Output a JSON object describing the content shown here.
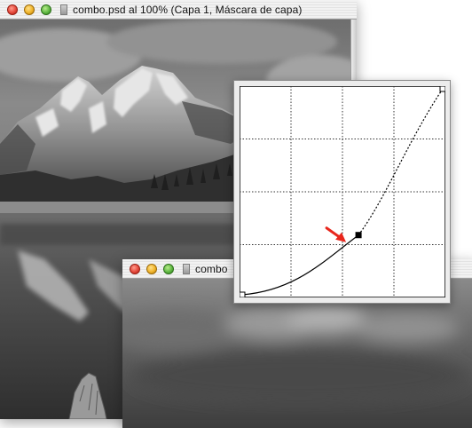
{
  "windows": {
    "main": {
      "title": "combo.psd al 100% (Capa 1, Máscara de capa)"
    },
    "second": {
      "title": "combo"
    }
  },
  "curves": {
    "grid_divisions": 4,
    "control_point": {
      "input": 0.58,
      "output": 0.29
    },
    "arrow_color": "#e8261c"
  },
  "colors": {
    "close": "#e5483b",
    "minimize": "#f0b42a",
    "zoom": "#5fb843"
  }
}
